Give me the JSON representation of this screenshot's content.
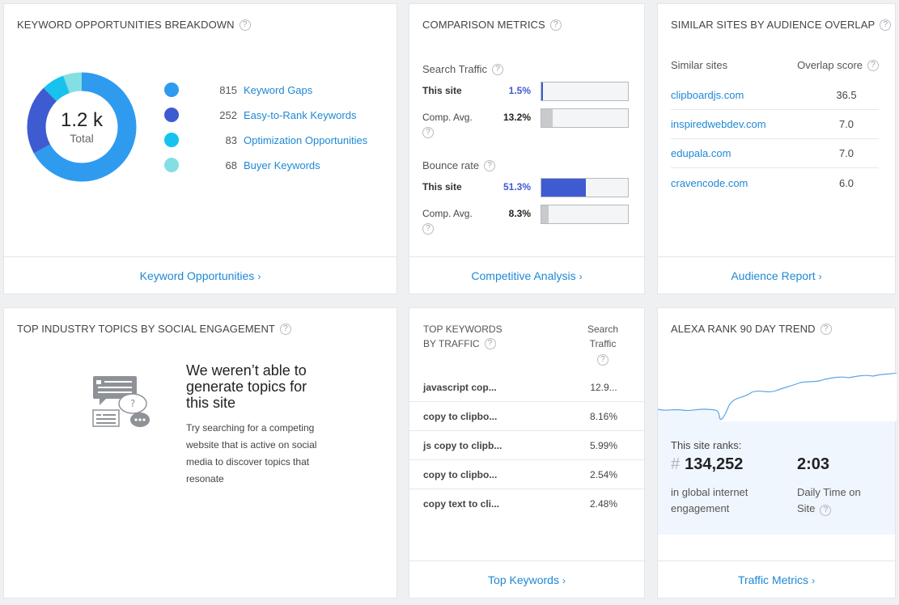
{
  "keyword_breakdown": {
    "title": "KEYWORD OPPORTUNITIES BREAKDOWN",
    "total_value": "1.2 k",
    "total_label": "Total",
    "items": [
      {
        "count": "815",
        "label": "Keyword Gaps",
        "color": "#2f9bef"
      },
      {
        "count": "252",
        "label": "Easy-to-Rank Keywords",
        "color": "#3f5bd1"
      },
      {
        "count": "83",
        "label": "Optimization Opportunities",
        "color": "#18c2ee"
      },
      {
        "count": "68",
        "label": "Buyer Keywords",
        "color": "#84dfe2"
      }
    ],
    "footer_link": "Keyword Opportunities"
  },
  "comparison": {
    "title": "COMPARISON METRICS",
    "search_traffic": {
      "label": "Search Traffic",
      "this_site_label": "This site",
      "this_site_value": "1.5%",
      "this_site_fraction": 0.015,
      "comp_label": "Comp. Avg.",
      "comp_value": "13.2%",
      "comp_fraction": 0.132
    },
    "bounce_rate": {
      "label": "Bounce rate",
      "this_site_label": "This site",
      "this_site_value": "51.3%",
      "this_site_fraction": 0.513,
      "comp_label": "Comp. Avg.",
      "comp_value": "8.3%",
      "comp_fraction": 0.083
    },
    "footer_link": "Competitive Analysis"
  },
  "similar_sites": {
    "title": "SIMILAR SITES BY AUDIENCE OVERLAP",
    "col_site": "Similar sites",
    "col_score": "Overlap score",
    "rows": [
      {
        "site": "clipboardjs.com",
        "score": "36.5"
      },
      {
        "site": "inspiredwebdev.com",
        "score": "7.0"
      },
      {
        "site": "edupala.com",
        "score": "7.0"
      },
      {
        "site": "cravencode.com",
        "score": "6.0"
      }
    ],
    "footer_link": "Audience Report"
  },
  "topics": {
    "title": "TOP INDUSTRY TOPICS BY SOCIAL ENGAGEMENT",
    "heading": "We weren’t able to generate topics for this site",
    "body": "Try searching for a competing website that is active on social media to discover topics that resonate"
  },
  "top_keywords": {
    "title_line1": "TOP KEYWORDS",
    "title_line2": "BY TRAFFIC",
    "col_line1": "Search",
    "col_line2": "Traffic",
    "rows": [
      {
        "keyword": "javascript cop...",
        "traffic": "12.9..."
      },
      {
        "keyword": "copy to clipbo...",
        "traffic": "8.16%"
      },
      {
        "keyword": "js copy to clipb...",
        "traffic": "5.99%"
      },
      {
        "keyword": "copy to clipbo...",
        "traffic": "2.54%"
      },
      {
        "keyword": "copy text to cli...",
        "traffic": "2.48%"
      }
    ],
    "footer_link": "Top Keywords"
  },
  "alexa": {
    "title": "ALEXA RANK 90 DAY TREND",
    "ranks_label": "This site ranks:",
    "hash": "#",
    "rank": "134,252",
    "rank_caption": "in global internet engagement",
    "time": "2:03",
    "time_caption": "Daily Time on Site",
    "line_color": "#5aa6e6",
    "footer_link": "Traffic Metrics"
  },
  "colors": {
    "link": "#1e88d6",
    "bar_this_site": "#3f5bd1",
    "bar_comp": "#c8cacd"
  }
}
